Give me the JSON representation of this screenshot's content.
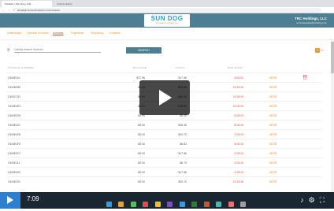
{
  "browser": {
    "tabs": [
      "Portfolio • Sun Dog | Coll...",
      "Invoice History"
    ],
    "url": "sundogit.connect/customer.com/invoices"
  },
  "header": {
    "logo": "SUN DOG",
    "logo_sub": "INFORMATION TECHNOLOGY",
    "company": "TRC Holdings, LLC",
    "email": "accountspayable@trcholdings.com"
  },
  "menu": [
    "Dashboard",
    "Opened Invoices",
    "Invoices",
    "Payments",
    "Reporting",
    "Contacts"
  ],
  "search": {
    "placeholder": "Quickly search invoices",
    "button": "SEARCH"
  },
  "pagination": {
    "prev": "‹",
    "current": "1",
    "next": "2",
    "more": "›"
  },
  "table": {
    "headers": [
      "INVOICE NUMBER",
      "BALANCE",
      "TOTAL",
      "DUE DATE",
      ""
    ],
    "rows": [
      {
        "inv": "CW4E2cL",
        "bal": "$17.96",
        "total": "$17.96",
        "due": "3/15/20",
        "status": "NOTE"
      },
      {
        "inv": "CW4D350",
        "bal": "$0.00",
        "total": "$22.86",
        "due": "12/15/19",
        "status": "NOTE"
      },
      {
        "inv": "CW4C131",
        "bal": "$0.00",
        "total": "$84.45",
        "due": "11/16/19",
        "status": "NOTE"
      },
      {
        "inv": "CW4E4EC",
        "bal": "$0.00",
        "total": "$15.00",
        "due": "10/16/19",
        "status": "NOTE"
      },
      {
        "inv": "CW4D225",
        "bal": "$0.00",
        "total": "$6.25",
        "due": "9/15/19",
        "status": "NOTE"
      },
      {
        "inv": "CW4E421",
        "bal": "$0.00",
        "total": "$16.45",
        "due": "8/15/19",
        "status": "NOTE"
      },
      {
        "inv": "CW4E428",
        "bal": "$0.00",
        "total": "$20.72",
        "due": "7/15/19",
        "status": "NOTE"
      },
      {
        "inv": "CW4E1FE",
        "bal": "$0.00",
        "total": "$6.84",
        "due": "5/15/19",
        "status": "NOTE"
      },
      {
        "inv": "CW4E3C7",
        "bal": "$0.00",
        "total": "$17.96",
        "due": "2/15/19",
        "status": "NOTE"
      },
      {
        "inv": "CW4E111",
        "bal": "$0.00",
        "total": "$6.73",
        "due": "2/15/19",
        "status": "NOTE"
      },
      {
        "inv": "CW4E30Z",
        "bal": "$0.00",
        "total": "$17.96",
        "due": "1/15/19",
        "status": "NOTE"
      },
      {
        "inv": "CW4E231",
        "bal": "$0.00",
        "total": "$20.72",
        "due": "12/15/18",
        "status": "NOTE"
      }
    ]
  },
  "player": {
    "time": "7:09"
  },
  "colors": {
    "header": "#4d7e92",
    "accent": "#e79b2d",
    "due": "#d9534f"
  }
}
